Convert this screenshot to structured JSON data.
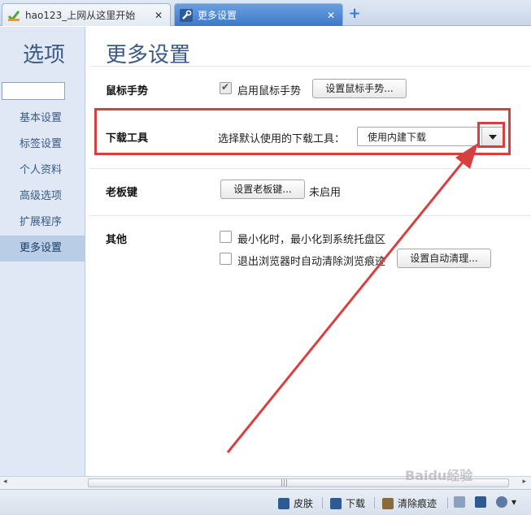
{
  "tabs": [
    {
      "title": "hao123_上网从这里开始",
      "close": "✕",
      "favicon": "hao123-logo"
    },
    {
      "title": "更多设置",
      "close": "✕",
      "favicon": "wrench-icon"
    }
  ],
  "new_tab": "+",
  "sidebar": {
    "title": "选项",
    "search": {
      "value": "",
      "placeholder": ""
    },
    "items": [
      {
        "label": "基本设置"
      },
      {
        "label": "标签设置"
      },
      {
        "label": "个人资料"
      },
      {
        "label": "高级选项"
      },
      {
        "label": "扩展程序"
      },
      {
        "label": "更多设置",
        "active": true
      }
    ]
  },
  "main": {
    "title": "更多设置",
    "mouse_gesture": {
      "label": "鼠标手势",
      "checkbox_label": "启用鼠标手势",
      "checked": true,
      "button": "设置鼠标手势..."
    },
    "download_tool": {
      "label": "下载工具",
      "prompt": "选择默认使用的下载工具：",
      "selected": "使用内建下载"
    },
    "boss_key": {
      "label": "老板键",
      "button": "设置老板键...",
      "status": "未启用"
    },
    "other": {
      "label": "其他",
      "options": [
        {
          "label": "最小化时，最小化到系统托盘区",
          "checked": false
        },
        {
          "label": "退出浏览器时自动清除浏览痕迹",
          "checked": false
        }
      ],
      "auto_clean_button": "设置自动清理..."
    }
  },
  "scrollbar": {
    "left": "◂",
    "right": "▸",
    "grip": "|||"
  },
  "statusbar": {
    "skin": "皮肤",
    "download": "下载",
    "clear": "清除痕迹",
    "zoom_arrow": "▾"
  },
  "watermark": "Baidu经验",
  "colors": {
    "highlight": "#d84040",
    "accent": "#3a5a85",
    "active_tab": "#3c78c8"
  }
}
